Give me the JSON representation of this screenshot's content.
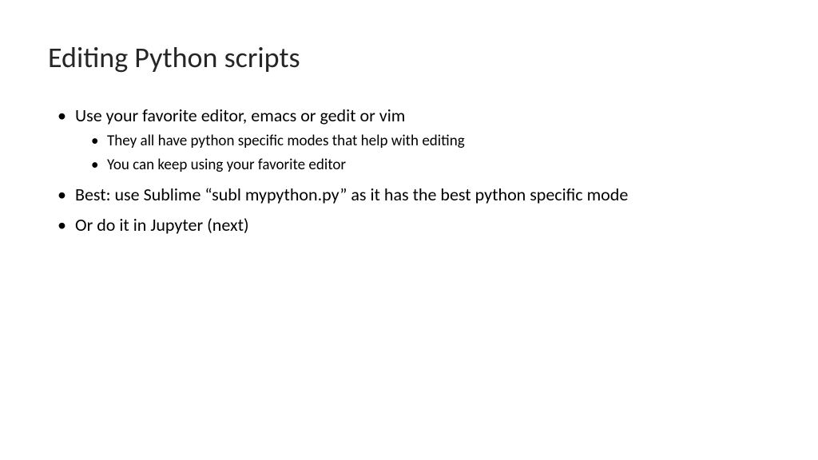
{
  "slide": {
    "title": "Editing Python scripts",
    "bullets": [
      {
        "text": "Use your favorite editor, emacs or gedit or vim",
        "sub": [
          "They all have python specific modes that help with editing",
          "You can keep using your favorite editor"
        ]
      },
      {
        "text": "Best: use Sublime “subl mypython.py” as it has the best python specific mode",
        "sub": []
      },
      {
        "text": "Or do it in Jupyter (next)",
        "sub": []
      }
    ]
  }
}
